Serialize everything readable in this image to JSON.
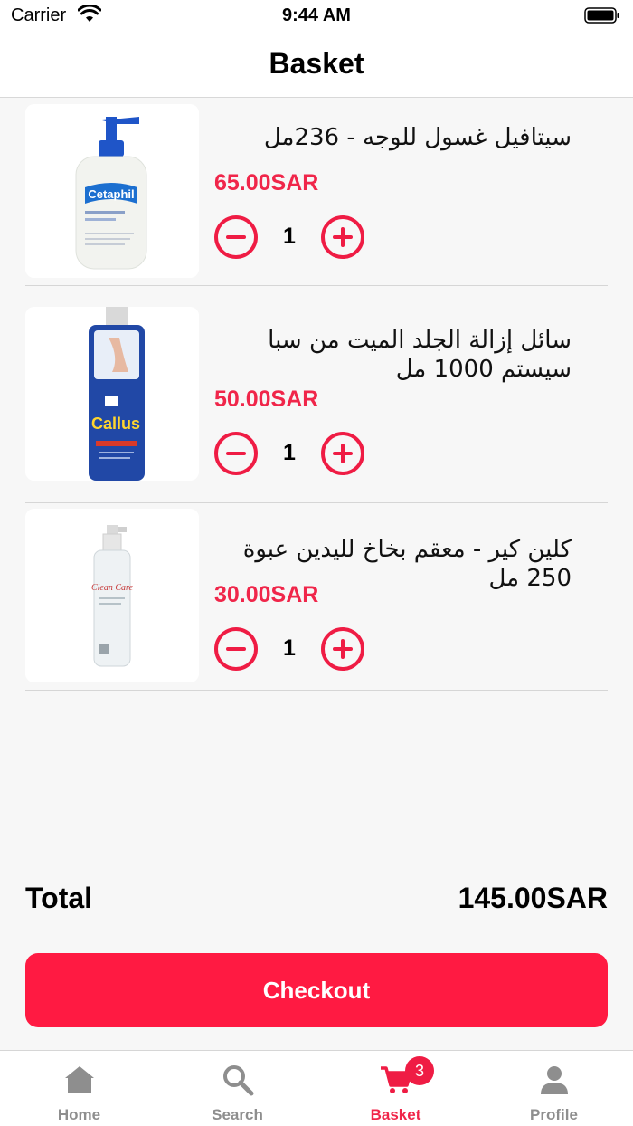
{
  "status_bar": {
    "carrier": "Carrier",
    "time": "9:44 AM"
  },
  "header": {
    "title": "Basket"
  },
  "items": [
    {
      "name": "سيتافيل غسول للوجه - 236مل",
      "price": "65.00SAR",
      "quantity": "1",
      "image_text": "Cetaphil"
    },
    {
      "name": "سائل إزالة الجلد الميت من سبا سيستم 1000 مل",
      "price": "50.00SAR",
      "quantity": "1",
      "image_text": "Callus"
    },
    {
      "name": "كلين كير - معقم بخاخ لليدين عبوة 250 مل",
      "price": "30.00SAR",
      "quantity": "1",
      "image_text": "Clean Care"
    }
  ],
  "summary": {
    "total_label": "Total",
    "total_value": "145.00SAR"
  },
  "checkout_label": "Checkout",
  "tabs": [
    {
      "label": "Home",
      "icon": "home-icon"
    },
    {
      "label": "Search",
      "icon": "search-icon"
    },
    {
      "label": "Basket",
      "icon": "cart-icon",
      "badge": "3",
      "active": true
    },
    {
      "label": "Profile",
      "icon": "user-icon"
    }
  ],
  "colors": {
    "accent": "#ef1c44",
    "price": "#f0264a",
    "background": "#f7f7f7"
  }
}
